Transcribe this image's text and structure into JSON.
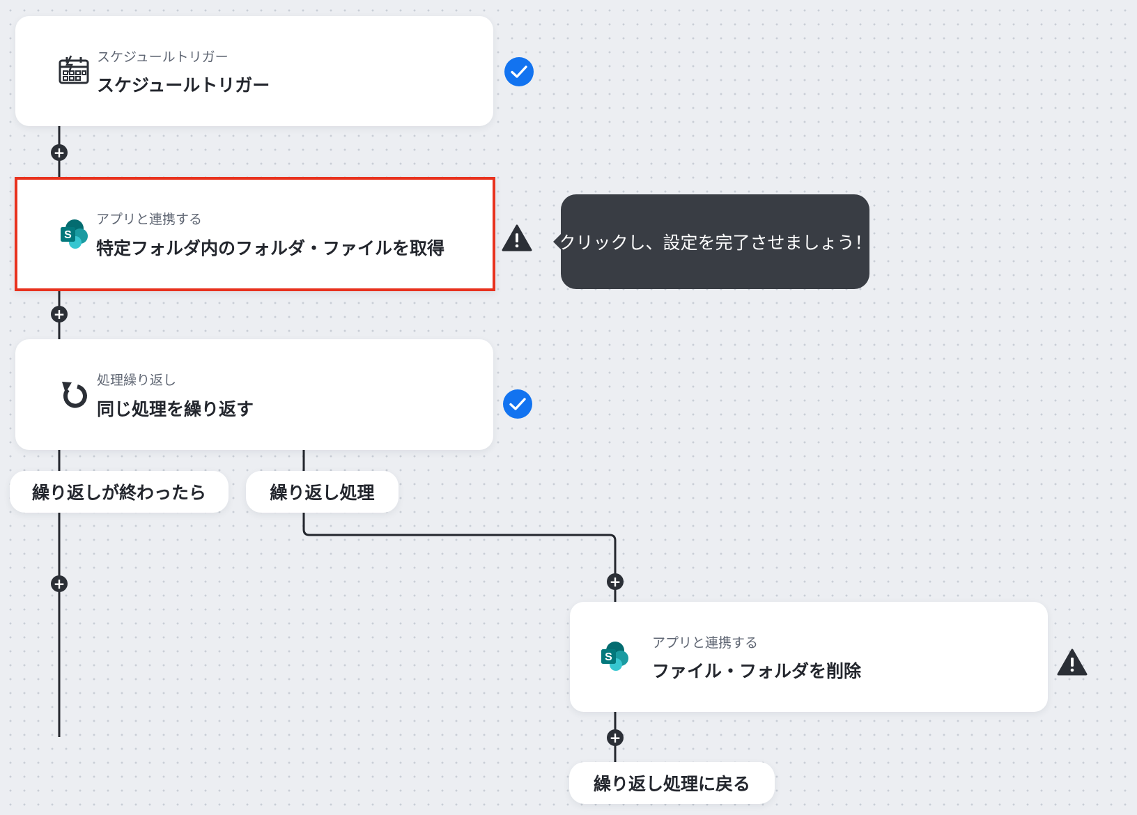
{
  "flow": {
    "steps": [
      {
        "category": "スケジュールトリガー",
        "title": "スケジュールトリガー",
        "icon": "schedule-trigger-icon",
        "status": "complete"
      },
      {
        "category": "アプリと連携する",
        "title": "特定フォルダ内のフォルダ・ファイルを取得",
        "icon": "sharepoint-icon",
        "status": "warning",
        "highlighted": true
      },
      {
        "category": "処理繰り返し",
        "title": "同じ処理を繰り返す",
        "icon": "loop-icon",
        "status": "complete"
      },
      {
        "category": "アプリと連携する",
        "title": "ファイル・フォルダを削除",
        "icon": "sharepoint-icon",
        "status": "warning"
      }
    ],
    "branches": {
      "after_loop": "繰り返しが終わったら",
      "loop_body": "繰り返し処理",
      "back_to_loop": "繰り返し処理に戻る"
    },
    "add_step_symbol": "+"
  },
  "tooltip": {
    "text": "クリックし、設定を完了させましょう！"
  },
  "colors": {
    "complete": "#1273f0",
    "warning": "#2b2f36",
    "highlight_border": "#e8321e",
    "sharepoint_dark": "#036c70",
    "sharepoint_mid": "#1a9ba1",
    "sharepoint_light": "#37c6d0"
  }
}
